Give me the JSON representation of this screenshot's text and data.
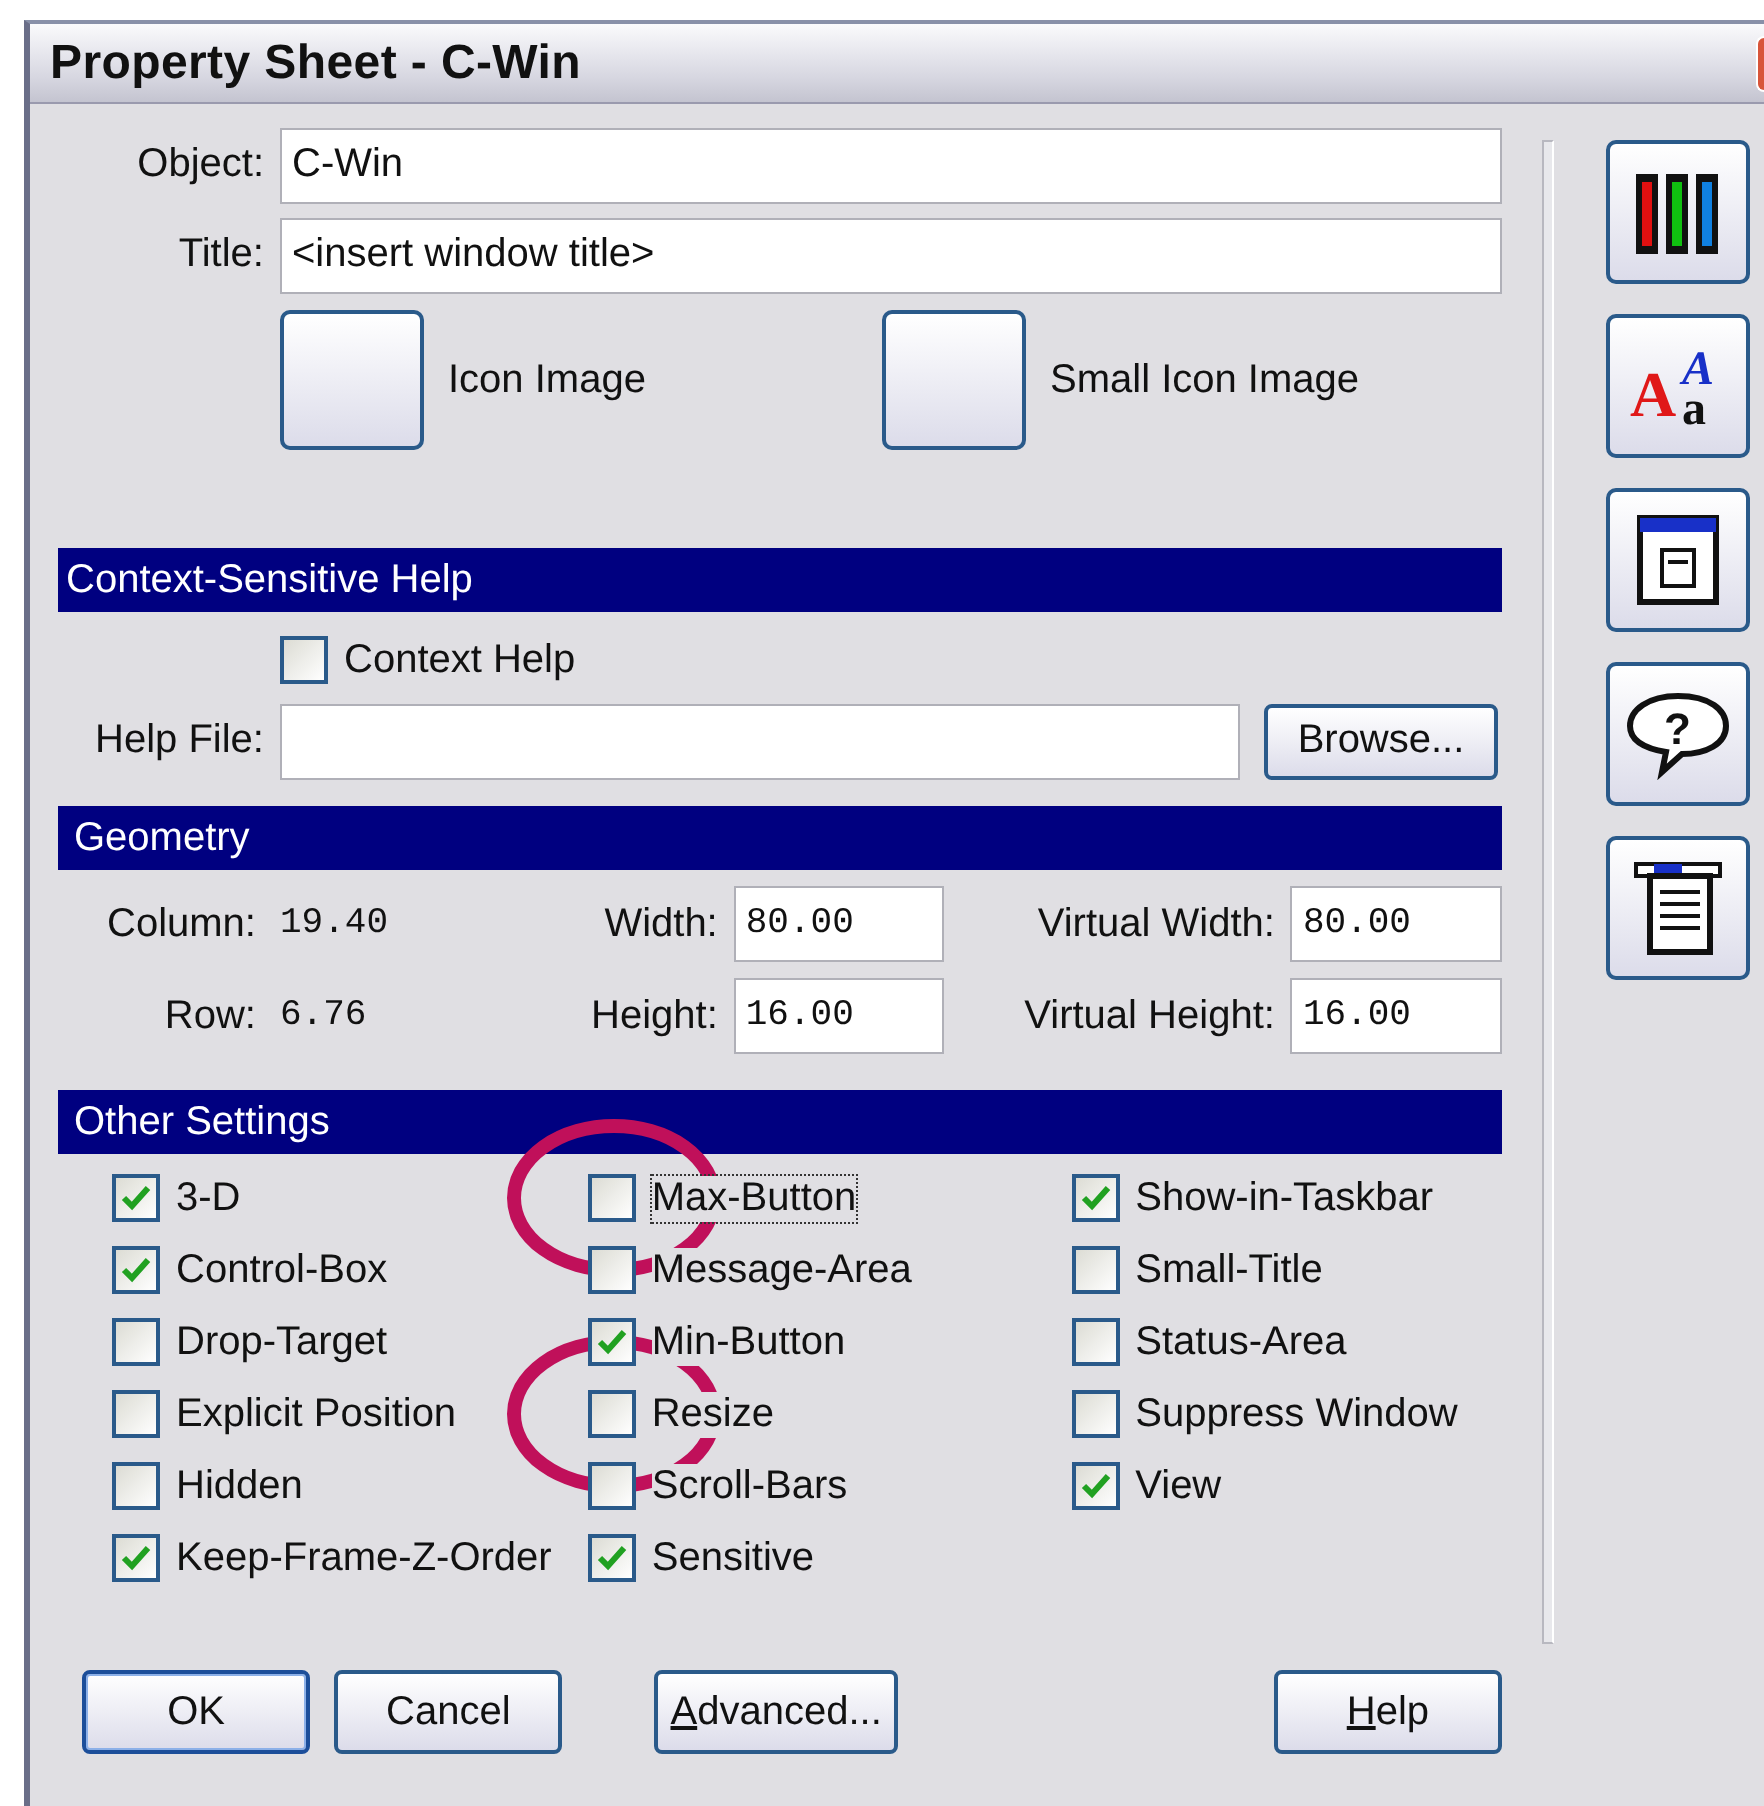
{
  "window": {
    "title": "Property Sheet - C-Win"
  },
  "object": {
    "label": "Object:",
    "value": "C-Win"
  },
  "title_field": {
    "label": "Title:",
    "value": "<insert window title>"
  },
  "images": [
    {
      "label": "Icon Image"
    },
    {
      "label": "Small Icon Image"
    }
  ],
  "context_help": {
    "header": "Context-Sensitive Help",
    "checkbox": {
      "label": "Context Help",
      "checked": false
    },
    "help_file": {
      "label": "Help File:"
    },
    "browse": "Browse..."
  },
  "geometry": {
    "header": "Geometry",
    "column": {
      "label": "Column:",
      "value": "19.40"
    },
    "row": {
      "label": "Row:",
      "value": "6.76"
    },
    "width": {
      "label": "Width:",
      "value": "80.00"
    },
    "height": {
      "label": "Height:",
      "value": "16.00"
    },
    "virtual_width": {
      "label": "Virtual Width:",
      "value": "80.00"
    },
    "virtual_height": {
      "label": "Virtual Height:",
      "value": "16.00"
    }
  },
  "other_settings": {
    "header": "Other Settings",
    "columns": [
      [
        {
          "label": "3-D",
          "checked": true,
          "circled": false,
          "focused": false
        },
        {
          "label": "Control-Box",
          "checked": true,
          "circled": false,
          "focused": false
        },
        {
          "label": "Drop-Target",
          "checked": false,
          "circled": false,
          "focused": false
        },
        {
          "label": "Explicit Position",
          "checked": false,
          "circled": false,
          "focused": false
        },
        {
          "label": "Hidden",
          "checked": false,
          "circled": false,
          "focused": false
        },
        {
          "label": "Keep-Frame-Z-Order",
          "checked": true,
          "circled": false,
          "focused": false
        }
      ],
      [
        {
          "label": "Max-Button",
          "checked": false,
          "circled": true,
          "focused": true
        },
        {
          "label": "Message-Area",
          "checked": false,
          "circled": false,
          "focused": false
        },
        {
          "label": "Min-Button",
          "checked": true,
          "circled": false,
          "focused": false
        },
        {
          "label": "Resize",
          "checked": false,
          "circled": true,
          "focused": false
        },
        {
          "label": "Scroll-Bars",
          "checked": false,
          "circled": false,
          "focused": false
        },
        {
          "label": "Sensitive",
          "checked": true,
          "circled": false,
          "focused": false
        }
      ],
      [
        {
          "label": "Show-in-Taskbar",
          "checked": true,
          "circled": false,
          "focused": false
        },
        {
          "label": "Small-Title",
          "checked": false,
          "circled": false,
          "focused": false
        },
        {
          "label": "Status-Area",
          "checked": false,
          "circled": false,
          "focused": false
        },
        {
          "label": "Suppress Window",
          "checked": false,
          "circled": false,
          "focused": false
        },
        {
          "label": "View",
          "checked": true,
          "circled": false,
          "focused": false
        }
      ]
    ]
  },
  "toolbar": [
    {
      "kind": "colors"
    },
    {
      "kind": "font",
      "big": "A",
      "small_top": "A",
      "small_bottom": "a"
    },
    {
      "kind": "window"
    },
    {
      "kind": "help",
      "mark": "?"
    },
    {
      "kind": "list"
    }
  ],
  "buttons": [
    {
      "label": "OK",
      "underline_first": false,
      "default": true
    },
    {
      "label": "Cancel",
      "underline_first": false,
      "default": false
    },
    {
      "label": "Advanced...",
      "underline_first": true,
      "default": false
    },
    {
      "label": "Help",
      "underline_first": true,
      "default": false
    }
  ]
}
